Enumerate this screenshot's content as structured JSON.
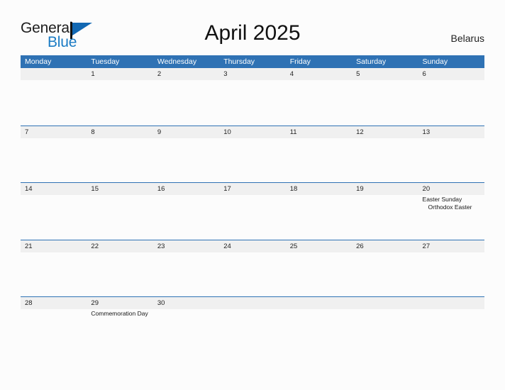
{
  "brand": {
    "word_one": "General",
    "word_two": "Blue",
    "flag_icon": "general-blue-flag-logo"
  },
  "header": {
    "title": "April 2025",
    "country": "Belarus"
  },
  "colors": {
    "header_blue": "#2f72b4",
    "band_gray": "#f0f0f0",
    "logo_blue": "#1a7bc4",
    "page_background": "#fcfcfc"
  },
  "calendar": {
    "weekdays": [
      "Monday",
      "Tuesday",
      "Wednesday",
      "Thursday",
      "Friday",
      "Saturday",
      "Sunday"
    ],
    "weeks": [
      [
        {
          "day": ""
        },
        {
          "day": "1"
        },
        {
          "day": "2"
        },
        {
          "day": "3"
        },
        {
          "day": "4"
        },
        {
          "day": "5"
        },
        {
          "day": "6"
        }
      ],
      [
        {
          "day": "7"
        },
        {
          "day": "8"
        },
        {
          "day": "9"
        },
        {
          "day": "10"
        },
        {
          "day": "11"
        },
        {
          "day": "12"
        },
        {
          "day": "13"
        }
      ],
      [
        {
          "day": "14"
        },
        {
          "day": "15"
        },
        {
          "day": "16"
        },
        {
          "day": "17"
        },
        {
          "day": "18"
        },
        {
          "day": "19"
        },
        {
          "day": "20",
          "events": [
            {
              "text": "Easter Sunday",
              "indent": false
            },
            {
              "text": "Orthodox Easter",
              "indent": true
            }
          ]
        }
      ],
      [
        {
          "day": "21"
        },
        {
          "day": "22"
        },
        {
          "day": "23"
        },
        {
          "day": "24"
        },
        {
          "day": "25"
        },
        {
          "day": "26"
        },
        {
          "day": "27"
        }
      ],
      [
        {
          "day": "28"
        },
        {
          "day": "29",
          "events": [
            {
              "text": "Commemoration Day",
              "indent": false
            }
          ]
        },
        {
          "day": "30"
        },
        {
          "day": ""
        },
        {
          "day": ""
        },
        {
          "day": ""
        },
        {
          "day": ""
        }
      ]
    ]
  }
}
